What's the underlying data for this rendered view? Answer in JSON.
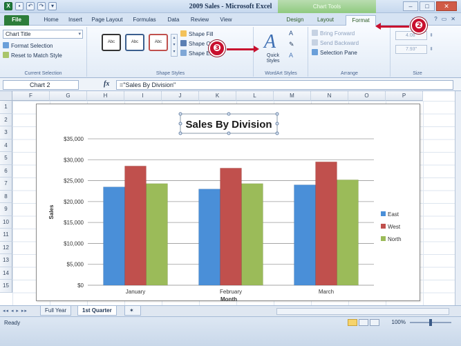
{
  "window": {
    "title": "2009 Sales - Microsoft Excel",
    "context_header": "Chart Tools"
  },
  "tabs": {
    "file": "File",
    "home": "Home",
    "insert": "Insert",
    "page_layout": "Page Layout",
    "formulas": "Formulas",
    "data": "Data",
    "review": "Review",
    "view": "View",
    "design": "Design",
    "layout": "Layout",
    "format": "Format"
  },
  "ribbon": {
    "current_selection": {
      "dropdown_value": "Chart Title",
      "format_selection": "Format Selection",
      "reset_style": "Reset to Match Style",
      "group_label": "Current Selection"
    },
    "shape_styles": {
      "swatch_text": "Abc",
      "shape_fill": "Shape Fill",
      "shape_outline": "Shape Outline",
      "shape_effects": "Shape Effects",
      "group_label": "Shape Styles"
    },
    "wordart_styles": {
      "quick_styles": "Quick Styles",
      "group_label": "WordArt Styles"
    },
    "arrange": {
      "bring_forward": "Bring Forward",
      "send_backward": "Send Backward",
      "selection_pane": "Selection Pane",
      "group_label": "Arrange"
    },
    "size": {
      "height": "4.08\"",
      "width": "7.93\"",
      "group_label": "Size"
    }
  },
  "callouts": {
    "step_two": "❷",
    "step_three": "❸"
  },
  "formula_bar": {
    "name_box": "Chart 2",
    "fx": "fx",
    "formula": "=\"Sales By Division\""
  },
  "grid": {
    "columns": [
      "F",
      "G",
      "H",
      "I",
      "J",
      "K",
      "L",
      "M",
      "N",
      "O",
      "P"
    ],
    "rows": [
      "1",
      "2",
      "3",
      "4",
      "5",
      "6",
      "7",
      "8",
      "9",
      "10",
      "11",
      "12",
      "13",
      "14",
      "15"
    ]
  },
  "chart_data": {
    "type": "bar",
    "title": "Sales By Division",
    "xlabel": "Month",
    "ylabel": "Sales",
    "categories": [
      "January",
      "February",
      "March"
    ],
    "series": [
      {
        "name": "East",
        "color": "#4a8fd8",
        "values": [
          23500,
          23000,
          24000
        ]
      },
      {
        "name": "West",
        "color": "#c0504d",
        "values": [
          28500,
          28000,
          29500
        ]
      },
      {
        "name": "North",
        "color": "#9bbb59",
        "values": [
          24300,
          24300,
          25200
        ]
      }
    ],
    "ylim": [
      0,
      35000
    ],
    "yticks": [
      "$0",
      "$5,000",
      "$10,000",
      "$15,000",
      "$20,000",
      "$25,000",
      "$30,000",
      "$35,000"
    ],
    "grid": true,
    "legend_position": "right"
  },
  "sheets": {
    "full_year": "Full Year",
    "first_quarter": "1st Quarter"
  },
  "status": {
    "ready": "Ready",
    "zoom": "100%"
  }
}
